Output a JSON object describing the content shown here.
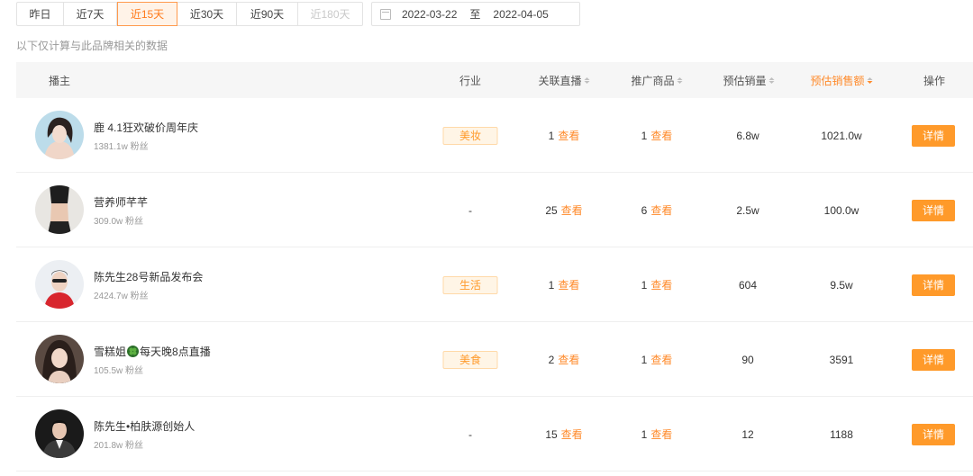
{
  "filters": {
    "ranges": [
      {
        "label": "昨日",
        "state": "normal"
      },
      {
        "label": "近7天",
        "state": "normal"
      },
      {
        "label": "近15天",
        "state": "active"
      },
      {
        "label": "近30天",
        "state": "normal"
      },
      {
        "label": "近90天",
        "state": "normal"
      },
      {
        "label": "近180天",
        "state": "disabled"
      }
    ],
    "date_start": "2022-03-22",
    "date_separator": "至",
    "date_end": "2022-04-05",
    "calendar_icon": "calendar-icon"
  },
  "note": "以下仅计算与此品牌相关的数据",
  "table": {
    "headers": {
      "anchor": "播主",
      "industry": "行业",
      "live": "关联直播",
      "goods": "推广商品",
      "sales": "预估销量",
      "amount": "预估销售额",
      "action": "操作"
    },
    "sorted_column": "amount",
    "link_label": "查看",
    "detail_label": "详情",
    "rows": [
      {
        "name": "鹿 4.1狂欢破价周年庆",
        "fans": "1381.1w 粉丝",
        "industry": "美妆",
        "live_count": "1",
        "goods_count": "1",
        "sales": "6.8w",
        "amount": "1021.0w"
      },
      {
        "name": "营养师芊芊",
        "fans": "309.0w 粉丝",
        "industry": "-",
        "live_count": "25",
        "goods_count": "6",
        "sales": "2.5w",
        "amount": "100.0w"
      },
      {
        "name": "陈先生28号新品发布会",
        "fans": "2424.7w 粉丝",
        "industry": "生活",
        "live_count": "1",
        "goods_count": "1",
        "sales": "604",
        "amount": "9.5w"
      },
      {
        "name_before": "雪糕姐",
        "name_icon": "four-leaf-clover-icon",
        "name_after": "每天晚8点直播",
        "fans": "105.5w 粉丝",
        "industry": "美食",
        "live_count": "2",
        "goods_count": "1",
        "sales": "90",
        "amount": "3591"
      },
      {
        "name": "陈先生•柏肤源创始人",
        "fans": "201.8w 粉丝",
        "industry": "-",
        "live_count": "15",
        "goods_count": "1",
        "sales": "12",
        "amount": "1188"
      }
    ]
  },
  "colors": {
    "accent": "#ff8a2a",
    "button": "#ff9a2a",
    "tag_bg": "#fff5e6",
    "header_bg": "#f6f6f6"
  }
}
